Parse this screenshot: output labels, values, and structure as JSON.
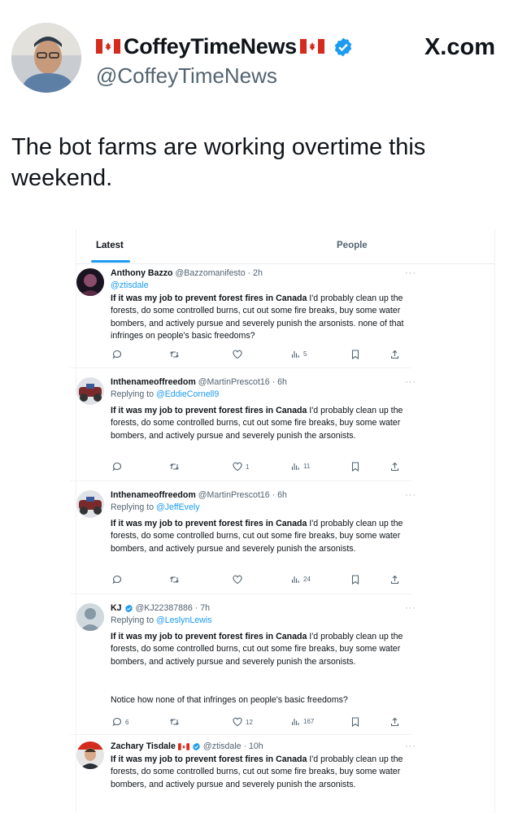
{
  "header": {
    "display_name": "CoffeyTimeNews",
    "handle": "@CoffeyTimeNews",
    "site": "X.com"
  },
  "tweet": {
    "text": "The bot farms are working overtime this weekend."
  },
  "screenshot": {
    "tabs": {
      "latest": "Latest",
      "people": "People"
    },
    "replies": [
      {
        "name": "Anthony Bazzo",
        "meta": "@Bazzomanifesto · 2h",
        "mention": "@ztisdale",
        "bold": "If it was my job to prevent forest fires in Canada",
        "body": " I'd probably clean up the forests, do some controlled burns, cut out some fire breaks, buy some water bombers, and actively pursue and severely punish the arsonists.  none of that infringes on people's basic freedoms?",
        "replies_count": "",
        "likes": "",
        "views": "5"
      },
      {
        "name": "Inthenameoffreedom",
        "meta": "@MartinPrescot16 · 6h",
        "reply_prefix": "Replying to ",
        "reply_to": "@EddieCornell9",
        "bold": "If it was my job to prevent forest fires in Canada",
        "body": " I'd probably clean up the forests, do some controlled burns, cut out some fire breaks, buy some water bombers, and actively pursue and severely punish the arsonists.",
        "replies_count": "",
        "likes": "1",
        "views": "11"
      },
      {
        "name": "Inthenameoffreedom",
        "meta": "@MartinPrescot16 · 6h",
        "reply_prefix": "Replying to ",
        "reply_to": "@JeffEvely",
        "bold": "If it was my job to prevent forest fires in Canada",
        "body": " I'd probably clean up the forests, do some controlled burns, cut out some fire breaks, buy some water bombers, and actively pursue and severely punish the arsonists.",
        "replies_count": "",
        "likes": "",
        "views": "24"
      },
      {
        "name": "KJ",
        "meta": "@KJ22387886 · 7h",
        "reply_prefix": "Replying to ",
        "reply_to": "@LeslynLewis",
        "bold": "If it was my job to prevent forest fires in Canada",
        "body": " I'd probably clean up the forests, do some controlled burns, cut out some fire breaks, buy some water bombers, and actively pursue and severely punish the arsonists.",
        "extra": "Notice how none of that infringes on people's basic freedoms?",
        "replies_count": "6",
        "likes": "12",
        "views": "167"
      },
      {
        "name": "Zachary Tisdale",
        "meta": "@ztisdale · 10h",
        "bold": "If it was my job to prevent forest fires in Canada",
        "body": " I'd probably clean up the forests, do some controlled burns, cut out some fire breaks, buy some water bombers, and actively pursue and severely punish the arsonists."
      }
    ]
  },
  "colors": {
    "link": "#1d9bf0",
    "verified": "#1d9bf0",
    "muted": "#536471"
  }
}
